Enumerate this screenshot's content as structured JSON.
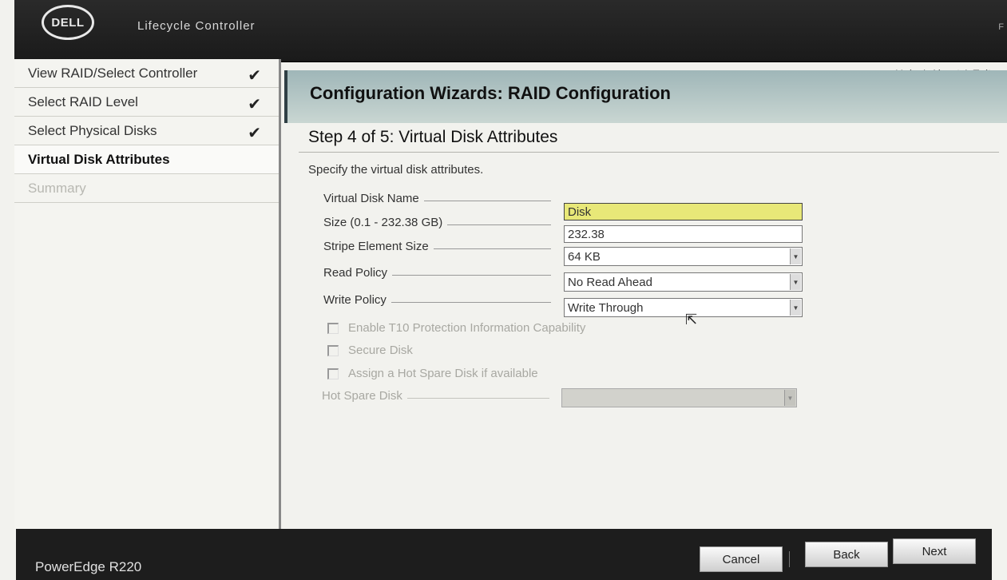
{
  "header": {
    "logo_text": "DELL",
    "app_title": "Lifecycle Controller",
    "edge_letter": "F"
  },
  "top_links": [
    "Help",
    "About",
    "Exit"
  ],
  "sidebar": {
    "items": [
      {
        "label": "View RAID/Select Controller",
        "checked": true
      },
      {
        "label": "Select RAID Level",
        "checked": true
      },
      {
        "label": "Select Physical Disks",
        "checked": true
      },
      {
        "label": "Virtual Disk Attributes",
        "state": "active"
      },
      {
        "label": "Summary",
        "state": "disabled"
      }
    ],
    "check_glyph": "✔"
  },
  "wizard": {
    "title": "Configuration Wizards: RAID Configuration",
    "step": "Step 4 of 5: Virtual Disk Attributes",
    "instructions": "Specify the virtual disk attributes."
  },
  "form": {
    "vd_name": {
      "label": "Virtual Disk Name",
      "value": "Disk"
    },
    "size": {
      "label": "Size (0.1 - 232.38 GB)",
      "value": "232.38"
    },
    "stripe": {
      "label": "Stripe Element Size",
      "value": "64 KB"
    },
    "read_policy": {
      "label": "Read Policy",
      "value": "No Read Ahead"
    },
    "write_policy": {
      "label": "Write Policy",
      "value": "Write Through"
    },
    "t10": {
      "label": "Enable T10 Protection Information Capability",
      "checked": false
    },
    "secure": {
      "label": "Secure Disk",
      "checked": false
    },
    "hot_spare_assign": {
      "label": "Assign a Hot Spare Disk if available",
      "checked": false
    },
    "hot_spare_disk": {
      "label": "Hot Spare Disk",
      "value": ""
    }
  },
  "footer": {
    "model": "PowerEdge R220",
    "cancel": "Cancel",
    "back": "Back",
    "next": "Next"
  }
}
